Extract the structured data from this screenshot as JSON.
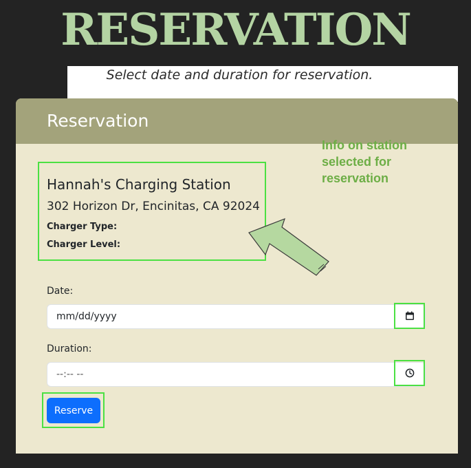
{
  "page": {
    "title": "RESERVATION",
    "subtitle": "Select date and duration for reservation."
  },
  "card": {
    "header": "Reservation",
    "station": {
      "name": "Hannah's Charging Station",
      "address": "302 Horizon Dr, Encinitas, CA 92024",
      "charger_type_label": "Charger Type:",
      "charger_level_label": "Charger Level:"
    },
    "date": {
      "label": "Date:",
      "value": "mm/dd/yyyy",
      "icon": "calendar-icon"
    },
    "duration": {
      "label": "Duration:",
      "value": "--:-- --",
      "icon": "clock-icon"
    },
    "reserve_button": "Reserve"
  },
  "annotation": {
    "text": "Info on station selected for reservation",
    "highlight_color": "#4be042",
    "text_color": "#6dae46",
    "arrow_color": "#b5d8a0"
  },
  "colors": {
    "background": "#232323",
    "title": "#b4d4a3",
    "card_header": "#a3a37b",
    "card_body": "#ede8cf",
    "button": "#0d6efd"
  }
}
